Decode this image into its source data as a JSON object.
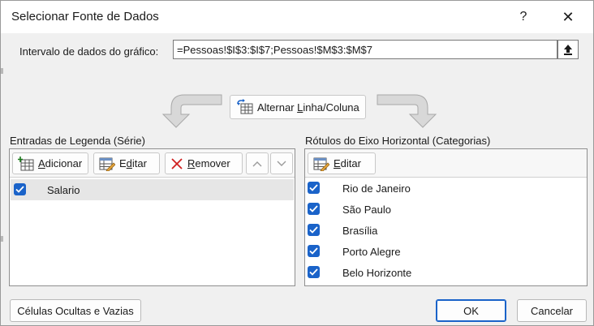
{
  "window": {
    "title": "Selecionar Fonte de Dados",
    "help_glyph": "?",
    "close_glyph": "✕"
  },
  "range": {
    "label": "Intervalo de dados do gráfico:",
    "value": "=Pessoas!$I$3:$I$7;Pessoas!$M$3:$M$7",
    "collapse_icon": "upload-arrow-icon"
  },
  "switch_button": {
    "label_prefix": "Alternar ",
    "label_underlined": "L",
    "label_suffix": "inha/Coluna",
    "icon": "switch-rows-columns-icon"
  },
  "legend_entries": {
    "label": "Entradas de Legenda (Série)",
    "add": {
      "underlined": "A",
      "rest": "dicionar",
      "icon": "add-series-icon"
    },
    "edit": {
      "prefix": "E",
      "underlined": "d",
      "rest": "itar",
      "icon": "edit-table-icon"
    },
    "remove": {
      "underlined": "R",
      "rest": "emover",
      "icon": "remove-x-icon"
    },
    "move_up_glyph": "︿",
    "move_down_glyph": "﹀",
    "series": [
      {
        "name": "Salario",
        "checked": true,
        "selected": true
      }
    ]
  },
  "horizontal_axis": {
    "label": "Rótulos do Eixo Horizontal (Categorias)",
    "edit": {
      "underlined": "E",
      "rest": "ditar",
      "icon": "edit-table-icon"
    },
    "categories": [
      {
        "name": "Rio de Janeiro",
        "checked": true
      },
      {
        "name": "São Paulo",
        "checked": true
      },
      {
        "name": "Brasília",
        "checked": true
      },
      {
        "name": "Porto Alegre",
        "checked": true
      },
      {
        "name": "Belo Horizonte",
        "checked": true
      }
    ]
  },
  "footer": {
    "hidden_cells": "Células Ocultas e Vazias",
    "ok": "OK",
    "cancel": "Cancelar"
  },
  "colors": {
    "accent": "#1a63c9",
    "selected_row": "#e6e6e6",
    "background": "#f0f0f0"
  }
}
